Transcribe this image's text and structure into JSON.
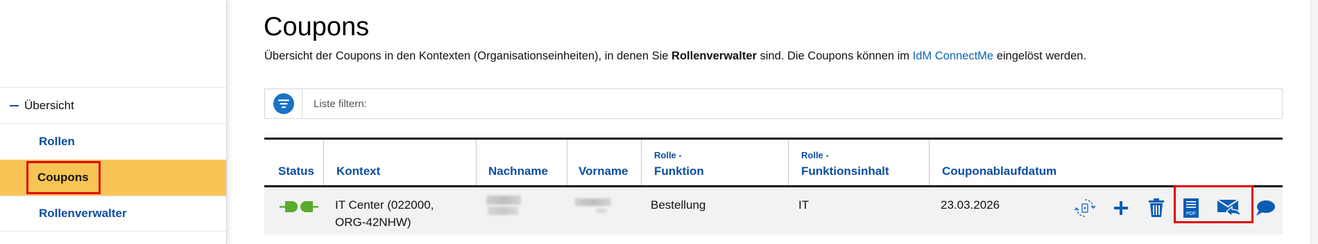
{
  "sidebar": {
    "items": [
      {
        "label": "Übersicht"
      },
      {
        "label": "Rollen"
      },
      {
        "label": "Coupons"
      },
      {
        "label": "Rollenverwalter"
      }
    ]
  },
  "page": {
    "title": "Coupons",
    "intro_part1": "Übersicht der Coupons in den Kontexten (Organisationseinheiten), in denen Sie ",
    "intro_bold": "Rollenverwalter",
    "intro_part2": " sind. Die Coupons können im ",
    "intro_link": "IdM ConnectMe",
    "intro_part3": " eingelöst werden."
  },
  "filter": {
    "placeholder": "Liste filtern:"
  },
  "table": {
    "headers": [
      {
        "sub": "",
        "label": "Status"
      },
      {
        "sub": "",
        "label": "Kontext"
      },
      {
        "sub": "",
        "label": "Nachname"
      },
      {
        "sub": "",
        "label": "Vorname"
      },
      {
        "sub": "Rolle -",
        "label": "Funktion"
      },
      {
        "sub": "Rolle -",
        "label": "Funktionsinhalt"
      },
      {
        "sub": "",
        "label": "Couponablaufdatum"
      }
    ],
    "rows": [
      {
        "kontext_line1": "IT Center (022000,",
        "kontext_line2": "ORG-42NHW)",
        "funktion": "Bestellung",
        "funktionsinhalt": "IT",
        "ablaufdatum": "23.03.2026",
        "pdf_icon_text": "PDF"
      }
    ]
  },
  "colors": {
    "accent_blue": "#0a4ea1",
    "link_blue": "#0a64b8",
    "active_nav": "#f8c453",
    "status_green": "#5aab2c",
    "highlight_red": "#e00000"
  },
  "icons": [
    "filter-icon",
    "plug-connected-icon",
    "refresh-coupon-icon",
    "plus-icon",
    "trash-icon",
    "pdf-document-icon",
    "mail-reply-icon",
    "comment-icon"
  ]
}
